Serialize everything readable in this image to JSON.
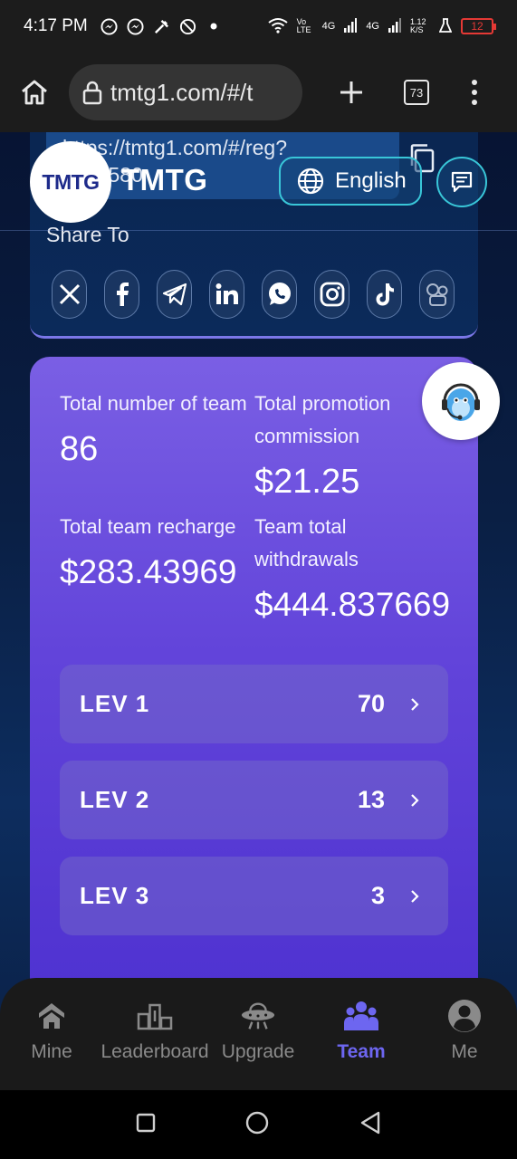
{
  "status_bar": {
    "time": "4:17 PM",
    "network_volte": "Vo LTE",
    "network_4g_1": "4G",
    "network_4g_2": "4G",
    "speed": "1.12 K/S",
    "battery": "12"
  },
  "browser": {
    "url": "tmtg1.com/#/t",
    "tab_count": "73"
  },
  "header": {
    "logo_text": "TMTG",
    "brand_name": "TMTG",
    "language_label": "English"
  },
  "share": {
    "link_line1": "https://tmtg1.com/#/reg?",
    "link_line2": "c=96580",
    "share_to_label": "Share To",
    "platforms": [
      "X",
      "Facebook",
      "Telegram",
      "LinkedIn",
      "WhatsApp",
      "Instagram",
      "TikTok",
      "More"
    ]
  },
  "stats": {
    "team_count_label": "Total number of team",
    "team_count_value": "86",
    "promotion_label": "Total promotion commission",
    "promotion_value": "$21.25",
    "recharge_label": "Total team recharge",
    "recharge_value": "$283.43969",
    "withdrawals_label": "Team total withdrawals",
    "withdrawals_value": "$444.837669"
  },
  "levels": [
    {
      "name": "LEV 1",
      "count": "70"
    },
    {
      "name": "LEV 2",
      "count": "13"
    },
    {
      "name": "LEV 3",
      "count": "3"
    }
  ],
  "bottom_nav": [
    {
      "label": "Mine",
      "icon": "home-icon",
      "active": false
    },
    {
      "label": "Leaderboard",
      "icon": "podium-icon",
      "active": false
    },
    {
      "label": "Upgrade",
      "icon": "ufo-icon",
      "active": false
    },
    {
      "label": "Team",
      "icon": "team-icon",
      "active": true
    },
    {
      "label": "Me",
      "icon": "user-icon",
      "active": false
    }
  ],
  "colors": {
    "accent": "#6d66f0",
    "card_top": "#7a5fe4",
    "card_bottom": "#4a2ed0",
    "header_border": "#39c6d8"
  }
}
